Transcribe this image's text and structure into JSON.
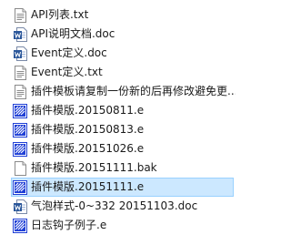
{
  "files": [
    {
      "name": "API列表.txt",
      "icon": "text-file-icon"
    },
    {
      "name": "API说明文档.doc",
      "icon": "word-doc-icon"
    },
    {
      "name": "Event定义.doc",
      "icon": "word-doc-icon"
    },
    {
      "name": "Event定义.txt",
      "icon": "text-file-icon"
    },
    {
      "name": "插件模板请复制一份新的后再修改避免更...",
      "icon": "text-file-icon"
    },
    {
      "name": "插件模版.20150811.e",
      "icon": "e-source-file-icon"
    },
    {
      "name": "插件模版.20150813.e",
      "icon": "e-source-file-icon"
    },
    {
      "name": "插件模版.20151026.e",
      "icon": "e-source-file-icon"
    },
    {
      "name": "插件模版.20151111.bak",
      "icon": "blank-file-icon"
    },
    {
      "name": "插件模版.20151111.e",
      "icon": "e-source-file-icon",
      "selected": true
    },
    {
      "name": "气泡样式-0~332   20151103.doc",
      "icon": "word-doc-icon"
    },
    {
      "name": "日志钩子例子.e",
      "icon": "e-source-file-icon"
    }
  ],
  "colors": {
    "selection_bg": "#cce8ff",
    "selection_border": "#99d1ff",
    "word_blue": "#2b579a",
    "e_icon_blue": "#1f3fd6"
  }
}
